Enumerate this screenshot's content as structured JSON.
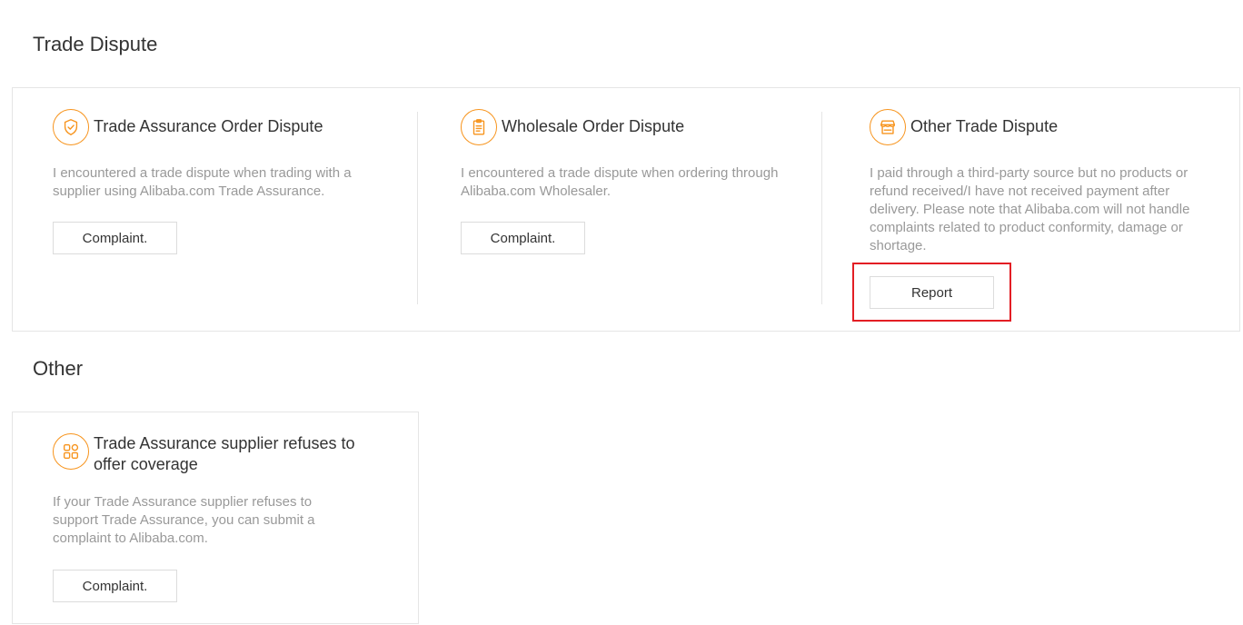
{
  "sections": [
    {
      "title": "Trade Dispute",
      "cards": [
        {
          "icon": "shield-check-icon",
          "title": "Trade Assurance Order Dispute",
          "description": "I encountered a trade dispute when trading with a supplier using Alibaba.com Trade Assurance.",
          "button_label": "Complaint."
        },
        {
          "icon": "clipboard-icon",
          "title": "Wholesale Order Dispute",
          "description": "I encountered a trade dispute when ordering through Alibaba.com Wholesaler.",
          "button_label": "Complaint."
        },
        {
          "icon": "storefront-icon",
          "title": "Other Trade Dispute",
          "description": "I paid through a third-party source but no products or refund received/I have not received payment after delivery. Please note that Alibaba.com will not handle complaints related to product conformity, damage or shortage.",
          "button_label": "Report"
        }
      ]
    },
    {
      "title": "Other",
      "cards": [
        {
          "icon": "grid-apps-icon",
          "title": "Trade Assurance supplier refuses to offer coverage",
          "description": "If your Trade Assurance supplier refuses to support Trade Assurance, you can submit a complaint to Alibaba.com.",
          "button_label": "Complaint."
        }
      ]
    }
  ],
  "colors": {
    "accent": "#f7941d",
    "highlight": "#e31e24",
    "muted_text": "#999999"
  }
}
